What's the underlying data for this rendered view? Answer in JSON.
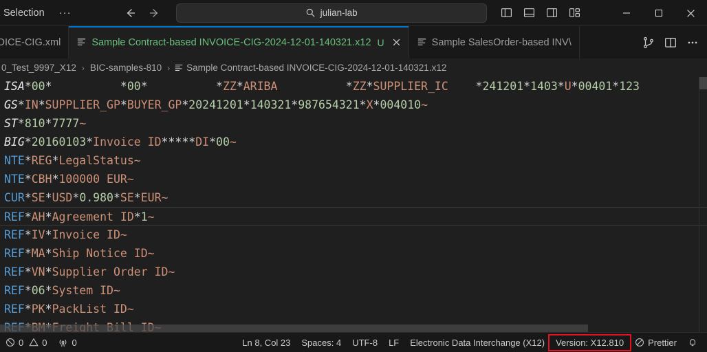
{
  "titlebar": {
    "menu_label": "Selection",
    "menu_overflow": "···",
    "back_icon": "arrow-left-icon",
    "forward_icon": "arrow-right-icon",
    "search": {
      "icon": "search-icon",
      "value": "julian-lab"
    },
    "layout_buttons": [
      {
        "name": "toggle-primary-sidebar-icon",
        "title": "Toggle Primary Side Bar"
      },
      {
        "name": "toggle-panel-icon",
        "title": "Toggle Panel"
      },
      {
        "name": "toggle-secondary-sidebar-icon",
        "title": "Toggle Secondary Side Bar"
      },
      {
        "name": "customize-layout-icon",
        "title": "Customize Layout"
      }
    ],
    "window_controls": [
      {
        "name": "minimize-button",
        "glyph": "minimize"
      },
      {
        "name": "maximize-button",
        "glyph": "maximize"
      },
      {
        "name": "close-button",
        "glyph": "close"
      }
    ]
  },
  "tabs": [
    {
      "label": "VOICE-CIG.xml",
      "icon": "edi-file-icon",
      "active": false,
      "truncated_left": true
    },
    {
      "label": "Sample Contract-based INVOICE-CIG-2024-12-01-140321.x12",
      "icon": "edi-file-icon",
      "active": true,
      "badge": "U",
      "close_icon": "close-icon"
    },
    {
      "label": "Sample SalesOrder-based INV\\",
      "icon": "edi-file-icon",
      "active": false
    }
  ],
  "tab_actions": [
    {
      "name": "source-control-icon",
      "title": "Source Control"
    },
    {
      "name": "split-editor-icon",
      "title": "Split Editor Right"
    },
    {
      "name": "more-actions-icon",
      "title": "More Actions...",
      "glyph": "···"
    }
  ],
  "breadcrumb": {
    "separator": "›",
    "items": [
      {
        "label": "0_Test_9997_X12",
        "icon": null
      },
      {
        "label": "BIC-samples-810",
        "icon": null
      },
      {
        "label": "Sample Contract-based INVOICE-CIG-2024-12-01-140321.x12",
        "icon": "edi-file-icon"
      }
    ]
  },
  "editor": {
    "current_line_index": 7,
    "lines": [
      {
        "segment": "ISA",
        "mandatory": true,
        "tokens": [
          {
            "t": "*",
            "c": "sep"
          },
          {
            "t": "00",
            "c": "num"
          },
          {
            "t": "*",
            "c": "sep"
          },
          {
            "t": "          ",
            "c": "str"
          },
          {
            "t": "*",
            "c": "sep"
          },
          {
            "t": "00",
            "c": "num"
          },
          {
            "t": "*",
            "c": "sep"
          },
          {
            "t": "          ",
            "c": "str"
          },
          {
            "t": "*",
            "c": "sep"
          },
          {
            "t": "ZZ",
            "c": "str"
          },
          {
            "t": "*",
            "c": "sep"
          },
          {
            "t": "ARIBA          ",
            "c": "str"
          },
          {
            "t": "*",
            "c": "sep"
          },
          {
            "t": "ZZ",
            "c": "str"
          },
          {
            "t": "*",
            "c": "sep"
          },
          {
            "t": "SUPPLIER_IC    ",
            "c": "str"
          },
          {
            "t": "*",
            "c": "sep"
          },
          {
            "t": "241201",
            "c": "num"
          },
          {
            "t": "*",
            "c": "sep"
          },
          {
            "t": "1403",
            "c": "num"
          },
          {
            "t": "*",
            "c": "sep"
          },
          {
            "t": "U",
            "c": "str"
          },
          {
            "t": "*",
            "c": "sep"
          },
          {
            "t": "00401",
            "c": "num"
          },
          {
            "t": "*",
            "c": "sep"
          },
          {
            "t": "123",
            "c": "num"
          }
        ]
      },
      {
        "segment": "GS",
        "mandatory": true,
        "tokens": [
          {
            "t": "*",
            "c": "sep"
          },
          {
            "t": "IN",
            "c": "str"
          },
          {
            "t": "*",
            "c": "sep"
          },
          {
            "t": "SUPPLIER_GP",
            "c": "str"
          },
          {
            "t": "*",
            "c": "sep"
          },
          {
            "t": "BUYER_GP",
            "c": "str"
          },
          {
            "t": "*",
            "c": "sep"
          },
          {
            "t": "20241201",
            "c": "num"
          },
          {
            "t": "*",
            "c": "sep"
          },
          {
            "t": "140321",
            "c": "num"
          },
          {
            "t": "*",
            "c": "sep"
          },
          {
            "t": "987654321",
            "c": "num"
          },
          {
            "t": "*",
            "c": "sep"
          },
          {
            "t": "X",
            "c": "str"
          },
          {
            "t": "*",
            "c": "sep"
          },
          {
            "t": "004010",
            "c": "num"
          },
          {
            "t": "~",
            "c": "term"
          }
        ]
      },
      {
        "segment": "ST",
        "mandatory": true,
        "tokens": [
          {
            "t": "*",
            "c": "sep"
          },
          {
            "t": "810",
            "c": "num"
          },
          {
            "t": "*",
            "c": "sep"
          },
          {
            "t": "7777",
            "c": "num"
          },
          {
            "t": "~",
            "c": "term"
          }
        ]
      },
      {
        "segment": "BIG",
        "mandatory": true,
        "tokens": [
          {
            "t": "*",
            "c": "sep"
          },
          {
            "t": "20160103",
            "c": "num"
          },
          {
            "t": "*",
            "c": "sep"
          },
          {
            "t": "Invoice ID",
            "c": "str"
          },
          {
            "t": "*",
            "c": "sep"
          },
          {
            "t": "*",
            "c": "sep"
          },
          {
            "t": "*",
            "c": "sep"
          },
          {
            "t": "*",
            "c": "sep"
          },
          {
            "t": "*",
            "c": "sep"
          },
          {
            "t": "DI",
            "c": "str"
          },
          {
            "t": "*",
            "c": "sep"
          },
          {
            "t": "00",
            "c": "num"
          },
          {
            "t": "~",
            "c": "term"
          }
        ]
      },
      {
        "segment": "NTE",
        "mandatory": false,
        "tokens": [
          {
            "t": "*",
            "c": "sep"
          },
          {
            "t": "REG",
            "c": "str"
          },
          {
            "t": "*",
            "c": "sep"
          },
          {
            "t": "LegalStatus",
            "c": "str"
          },
          {
            "t": "~",
            "c": "term"
          }
        ]
      },
      {
        "segment": "NTE",
        "mandatory": false,
        "tokens": [
          {
            "t": "*",
            "c": "sep"
          },
          {
            "t": "CBH",
            "c": "str"
          },
          {
            "t": "*",
            "c": "sep"
          },
          {
            "t": "100000 EUR",
            "c": "str"
          },
          {
            "t": "~",
            "c": "term"
          }
        ]
      },
      {
        "segment": "CUR",
        "mandatory": false,
        "tokens": [
          {
            "t": "*",
            "c": "sep"
          },
          {
            "t": "SE",
            "c": "str"
          },
          {
            "t": "*",
            "c": "sep"
          },
          {
            "t": "USD",
            "c": "str"
          },
          {
            "t": "*",
            "c": "sep"
          },
          {
            "t": "0.980",
            "c": "num"
          },
          {
            "t": "*",
            "c": "sep"
          },
          {
            "t": "SE",
            "c": "str"
          },
          {
            "t": "*",
            "c": "sep"
          },
          {
            "t": "EUR",
            "c": "str"
          },
          {
            "t": "~",
            "c": "term"
          }
        ]
      },
      {
        "segment": "REF",
        "mandatory": false,
        "tokens": [
          {
            "t": "*",
            "c": "sep"
          },
          {
            "t": "AH",
            "c": "str"
          },
          {
            "t": "*",
            "c": "sep"
          },
          {
            "t": "Agreement ID",
            "c": "str"
          },
          {
            "t": "*",
            "c": "sep"
          },
          {
            "t": "1",
            "c": "num"
          },
          {
            "t": "~",
            "c": "term"
          }
        ]
      },
      {
        "segment": "REF",
        "mandatory": false,
        "tokens": [
          {
            "t": "*",
            "c": "sep"
          },
          {
            "t": "IV",
            "c": "str"
          },
          {
            "t": "*",
            "c": "sep"
          },
          {
            "t": "Invoice ID",
            "c": "str"
          },
          {
            "t": "~",
            "c": "term"
          }
        ]
      },
      {
        "segment": "REF",
        "mandatory": false,
        "tokens": [
          {
            "t": "*",
            "c": "sep"
          },
          {
            "t": "MA",
            "c": "str"
          },
          {
            "t": "*",
            "c": "sep"
          },
          {
            "t": "Ship Notice ID",
            "c": "str"
          },
          {
            "t": "~",
            "c": "term"
          }
        ]
      },
      {
        "segment": "REF",
        "mandatory": false,
        "tokens": [
          {
            "t": "*",
            "c": "sep"
          },
          {
            "t": "VN",
            "c": "str"
          },
          {
            "t": "*",
            "c": "sep"
          },
          {
            "t": "Supplier Order ID",
            "c": "str"
          },
          {
            "t": "~",
            "c": "term"
          }
        ]
      },
      {
        "segment": "REF",
        "mandatory": false,
        "tokens": [
          {
            "t": "*",
            "c": "sep"
          },
          {
            "t": "06",
            "c": "num"
          },
          {
            "t": "*",
            "c": "sep"
          },
          {
            "t": "System ID",
            "c": "str"
          },
          {
            "t": "~",
            "c": "term"
          }
        ]
      },
      {
        "segment": "REF",
        "mandatory": false,
        "tokens": [
          {
            "t": "*",
            "c": "sep"
          },
          {
            "t": "PK",
            "c": "str"
          },
          {
            "t": "*",
            "c": "sep"
          },
          {
            "t": "PackList ID",
            "c": "str"
          },
          {
            "t": "~",
            "c": "term"
          }
        ]
      },
      {
        "segment": "REF",
        "mandatory": false,
        "tokens": [
          {
            "t": "*",
            "c": "sep"
          },
          {
            "t": "BM",
            "c": "str"
          },
          {
            "t": "*",
            "c": "sep"
          },
          {
            "t": "Freight Bill ID",
            "c": "str"
          },
          {
            "t": "~",
            "c": "term"
          }
        ]
      }
    ]
  },
  "statusbar": {
    "errors": {
      "icon": "error-icon",
      "count": "0"
    },
    "warnings": {
      "icon": "warning-icon",
      "count": "0"
    },
    "ports": {
      "icon": "remote-ports-icon",
      "count": "0"
    },
    "cursor_position": "Ln 8, Col 23",
    "indentation": "Spaces: 4",
    "encoding": "UTF-8",
    "eol": "LF",
    "language_mode": "Electronic Data Interchange (X12)",
    "version": "Version: X12.810",
    "formatter": {
      "icon": "prettier-block-icon",
      "label": "Prettier"
    },
    "notifications_icon": "bell-icon"
  },
  "colors": {
    "accent": "#0078d4",
    "tab_active_text": "#6bbf7b",
    "annotation_red": "#e81123",
    "segment_optional": "#569cd6",
    "value_numeric": "#b5cea8",
    "value_string": "#ce9178",
    "editor_bg": "#1f1f1f",
    "chrome_bg": "#181818"
  }
}
